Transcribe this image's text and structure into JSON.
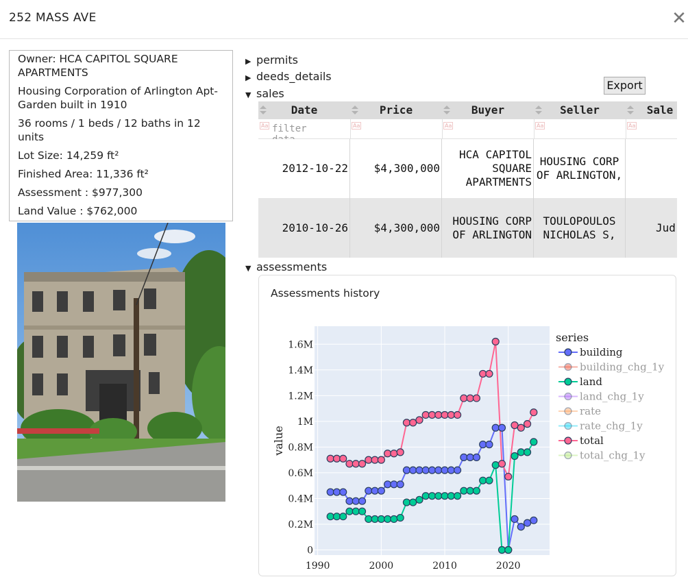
{
  "window": {
    "title": "252 MASS AVE",
    "close_glyph": "✕"
  },
  "info": {
    "owner": "Owner: HCA CAPITOL SQUARE APARTMENTS",
    "description": "Housing Corporation of Arlington Apt- Garden built in 1910",
    "rooms": "36 rooms / 1 beds / 12 baths in 12 units",
    "lot_size": "Lot Size: 14,259 ft²",
    "finished_area": "Finished Area: 11,336 ft²",
    "assessment": "Assessment : $977,300",
    "land_value": "Land Value : $762,000"
  },
  "sections": {
    "permits": "permits",
    "deeds": "deeds_details",
    "sales": "sales",
    "assessments": "assessments"
  },
  "export_label": "Export",
  "sales_table": {
    "columns": [
      "Date",
      "Price",
      "Buyer",
      "Seller",
      "Sale"
    ],
    "filter_placeholder": "filter data...",
    "rows": [
      {
        "date": "2012-10-22",
        "price": "$4,300,000",
        "buyer": "HCA CAPITOL SQUARE APARTMENTS",
        "seller": "HOUSING CORP OF ARLINGTON,",
        "sale": ""
      },
      {
        "date": "2010-10-26",
        "price": "$4,300,000",
        "buyer": "HOUSING CORP OF ARLINGTON",
        "seller": "TOULOPOULOS NICHOLAS S,",
        "sale": "Jud"
      }
    ]
  },
  "chart_title": "Assessments history",
  "chart_data": {
    "type": "line",
    "title": "Assessments history",
    "xlabel": "",
    "ylabel": "value",
    "xlim": [
      1989.5,
      2026.5
    ],
    "ylim": [
      -40000,
      1740000
    ],
    "x_ticks": [
      1990,
      2000,
      2010,
      2020
    ],
    "y_ticks": [
      {
        "v": 0,
        "label": "0"
      },
      {
        "v": 200000,
        "label": "0.2M"
      },
      {
        "v": 400000,
        "label": "0.4M"
      },
      {
        "v": 600000,
        "label": "0.6M"
      },
      {
        "v": 800000,
        "label": "0.8M"
      },
      {
        "v": 1000000,
        "label": "1M"
      },
      {
        "v": 1200000,
        "label": "1.2M"
      },
      {
        "v": 1400000,
        "label": "1.4M"
      },
      {
        "v": 1600000,
        "label": "1.6M"
      }
    ],
    "legend_title": "series",
    "legend_position": "right",
    "grid": true,
    "series": [
      {
        "name": "building",
        "color": "#636efa",
        "visible": true,
        "x": [
          1992,
          1993,
          1994,
          1995,
          1996,
          1997,
          1998,
          1999,
          2000,
          2001,
          2002,
          2003,
          2004,
          2005,
          2006,
          2007,
          2008,
          2009,
          2010,
          2011,
          2012,
          2013,
          2014,
          2015,
          2016,
          2017,
          2018,
          2019,
          2020,
          2021,
          2022,
          2023,
          2024
        ],
        "y": [
          450000,
          450000,
          450000,
          380000,
          380000,
          380000,
          460000,
          460000,
          460000,
          510000,
          510000,
          510000,
          620000,
          620000,
          620000,
          620000,
          620000,
          620000,
          620000,
          620000,
          620000,
          720000,
          720000,
          720000,
          820000,
          820000,
          950000,
          950000,
          0,
          240000,
          180000,
          210000,
          230000
        ]
      },
      {
        "name": "building_chg_1y",
        "color": "#ef553b",
        "visible": false,
        "x": [],
        "y": []
      },
      {
        "name": "land",
        "color": "#00cc96",
        "visible": true,
        "x": [
          1992,
          1993,
          1994,
          1995,
          1996,
          1997,
          1998,
          1999,
          2000,
          2001,
          2002,
          2003,
          2004,
          2005,
          2006,
          2007,
          2008,
          2009,
          2010,
          2011,
          2012,
          2013,
          2014,
          2015,
          2016,
          2017,
          2018,
          2019,
          2020,
          2021,
          2022,
          2023,
          2024
        ],
        "y": [
          260000,
          260000,
          260000,
          300000,
          300000,
          300000,
          240000,
          240000,
          240000,
          240000,
          240000,
          250000,
          370000,
          370000,
          390000,
          420000,
          420000,
          420000,
          420000,
          420000,
          420000,
          460000,
          460000,
          460000,
          540000,
          540000,
          660000,
          0,
          0,
          730000,
          760000,
          760000,
          840000
        ]
      },
      {
        "name": "land_chg_1y",
        "color": "#ab63fa",
        "visible": false,
        "x": [],
        "y": []
      },
      {
        "name": "rate",
        "color": "#ffa15a",
        "visible": false,
        "x": [],
        "y": []
      },
      {
        "name": "rate_chg_1y",
        "color": "#19d3f3",
        "visible": false,
        "x": [],
        "y": []
      },
      {
        "name": "total",
        "color": "#ff6692",
        "visible": true,
        "x": [
          1992,
          1993,
          1994,
          1995,
          1996,
          1997,
          1998,
          1999,
          2000,
          2001,
          2002,
          2003,
          2004,
          2005,
          2006,
          2007,
          2008,
          2009,
          2010,
          2011,
          2012,
          2013,
          2014,
          2015,
          2016,
          2017,
          2018,
          2019,
          2020,
          2021,
          2022,
          2023,
          2024
        ],
        "y": [
          710000,
          710000,
          710000,
          670000,
          670000,
          670000,
          700000,
          700000,
          700000,
          750000,
          750000,
          760000,
          990000,
          990000,
          1010000,
          1050000,
          1050000,
          1050000,
          1050000,
          1050000,
          1050000,
          1180000,
          1180000,
          1180000,
          1370000,
          1370000,
          1620000,
          670000,
          570000,
          970000,
          950000,
          980000,
          1070000
        ]
      },
      {
        "name": "total_chg_1y",
        "color": "#b6e880",
        "visible": false,
        "x": [],
        "y": []
      }
    ]
  }
}
